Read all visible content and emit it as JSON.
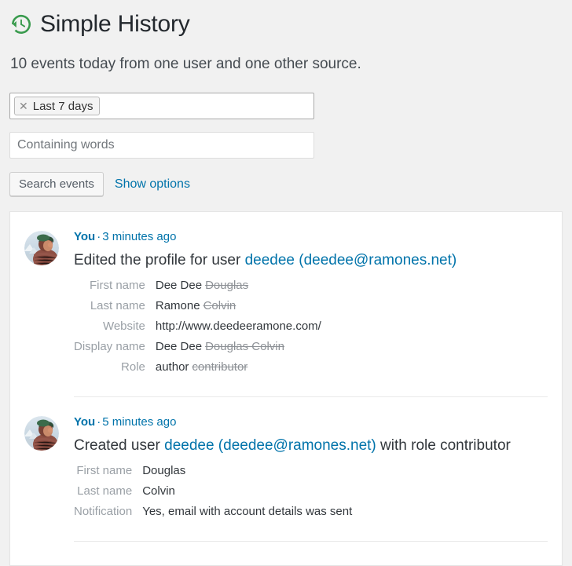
{
  "header": {
    "icon": "history-clock-icon",
    "title": "Simple History",
    "subtitle": "10 events today from one user and one other source."
  },
  "filters": {
    "date_tag": {
      "remove_icon": "remove-x-icon",
      "label": "Last 7 days"
    },
    "words_placeholder": "Containing words",
    "words_value": "",
    "search_button": "Search events",
    "show_options_link": "Show options"
  },
  "events": [
    {
      "avatar": "user-photo-avatar",
      "user": "You",
      "separator": "·",
      "time": "3 minutes ago",
      "headline_pre": "Edited the profile for user ",
      "headline_link": "deedee (deedee@ramones.net)",
      "headline_post": "",
      "details": [
        {
          "key": "First name",
          "value": "Dee Dee",
          "old": "Douglas"
        },
        {
          "key": "Last name",
          "value": "Ramone",
          "old": "Colvin"
        },
        {
          "key": "Website",
          "value": "http://www.deedeeramone.com/",
          "old": ""
        },
        {
          "key": "Display name",
          "value": "Dee Dee",
          "old": "Douglas Colvin"
        },
        {
          "key": "Role",
          "value": "author",
          "old": "contributor"
        }
      ]
    },
    {
      "avatar": "user-photo-avatar",
      "user": "You",
      "separator": "·",
      "time": "5 minutes ago",
      "headline_pre": "Created user ",
      "headline_link": "deedee (deedee@ramones.net)",
      "headline_post": " with role contributor",
      "details": [
        {
          "key": "First name",
          "value": "Douglas",
          "old": ""
        },
        {
          "key": "Last name",
          "value": "Colvin",
          "old": ""
        },
        {
          "key": "Notification",
          "value": "Yes, email with account details was sent",
          "old": ""
        }
      ]
    }
  ],
  "colors": {
    "link": "#0073aa",
    "icon_green": "#3a9b4e",
    "page_bg": "#f1f1f1",
    "text": "#32373c",
    "muted": "#9aa0a6"
  }
}
